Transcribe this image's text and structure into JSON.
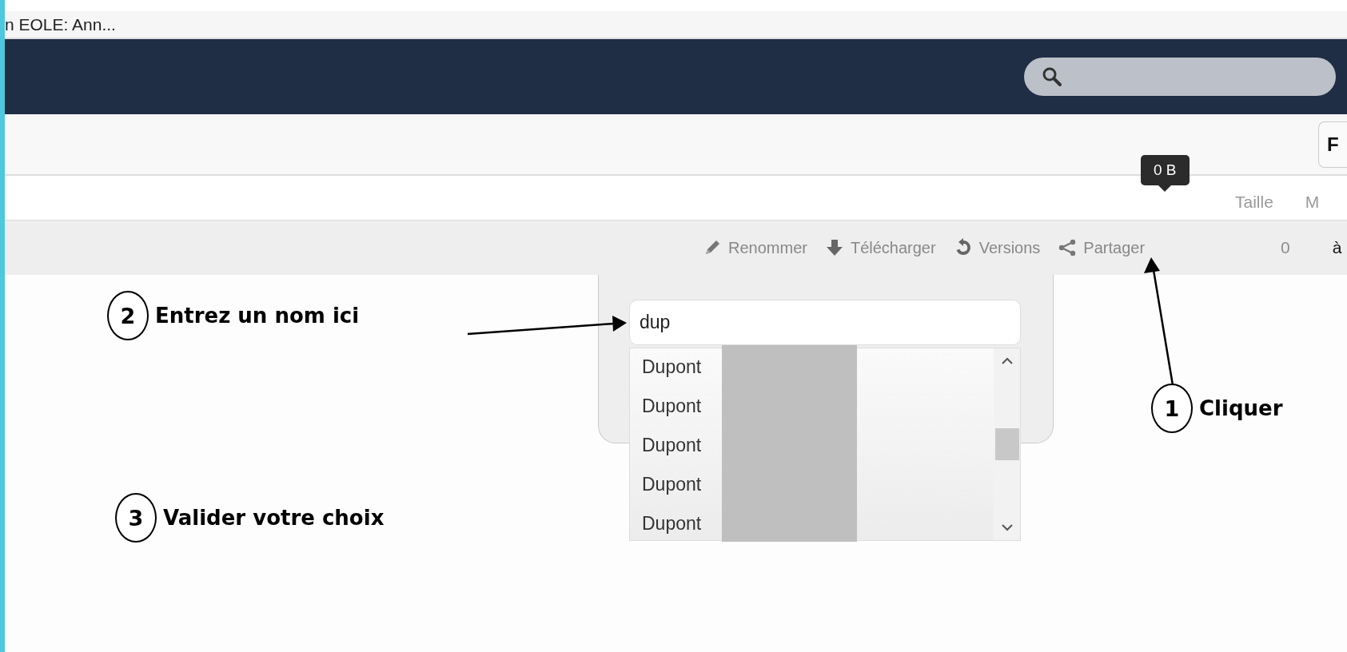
{
  "browser_tab": {
    "title": "n EOLE: Ann..."
  },
  "toolbar": {
    "button_label": "F"
  },
  "file_list": {
    "columns": [
      "Taille",
      "M"
    ],
    "size_tooltip": "0 B",
    "row": {
      "actions": [
        {
          "kind": "rename",
          "label": "Renommer"
        },
        {
          "kind": "download",
          "label": "Télécharger"
        },
        {
          "kind": "versions",
          "label": "Versions"
        },
        {
          "kind": "share",
          "label": "Partager"
        }
      ],
      "cells": [
        "0",
        "à"
      ]
    }
  },
  "share_panel": {
    "input_value": "dup",
    "suggestions": [
      {
        "label": "Dupont"
      },
      {
        "label": "Dupont"
      },
      {
        "label": "Dupont"
      },
      {
        "label": "Dupont"
      },
      {
        "label": "Dupont"
      }
    ]
  },
  "annotations": [
    {
      "number": "2",
      "text": "Entrez un nom ici"
    },
    {
      "number": "3",
      "text": "Valider votre choix"
    },
    {
      "number": "1",
      "text": "Cliquer"
    }
  ]
}
